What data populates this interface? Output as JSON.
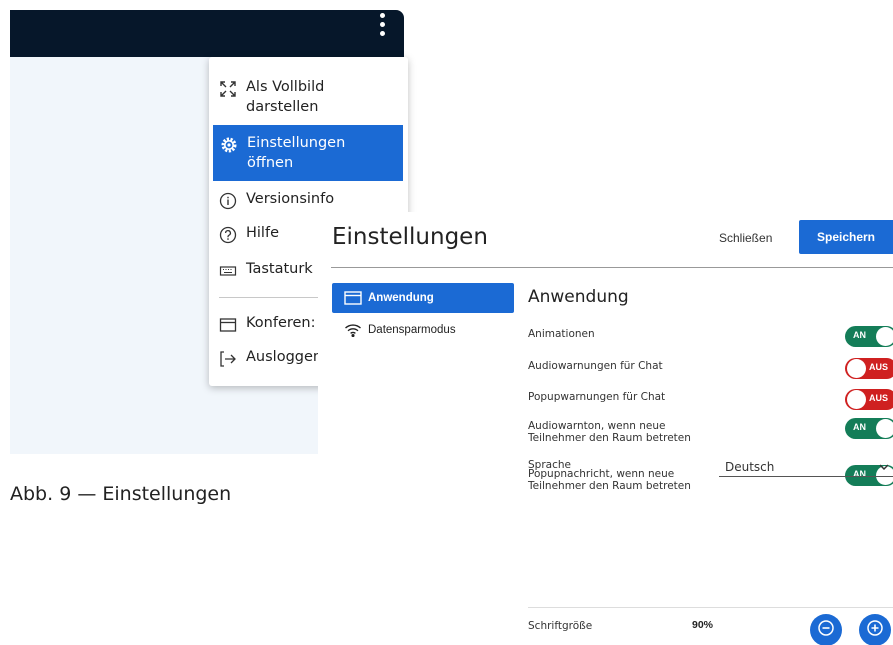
{
  "app_menu": {
    "items": [
      {
        "label": "Als Vollbild\ndarstellen",
        "icon": "fullscreen-icon"
      },
      {
        "label": "Einstellungen\nöffnen",
        "icon": "gear-icon",
        "active": true
      },
      {
        "label": "Versionsinfo",
        "icon": "info-icon"
      },
      {
        "label": "Hilfe",
        "icon": "help-icon"
      },
      {
        "label": "Tastaturk",
        "icon": "keyboard-icon"
      },
      {
        "label": "Konferen:",
        "icon": "window-icon"
      },
      {
        "label": "Ausloggen",
        "icon": "logout-icon"
      }
    ]
  },
  "caption": "Abb. 9 — Einstellungen",
  "dialog": {
    "title": "Einstellungen",
    "close_label": "Schließen",
    "save_label": "Speichern",
    "nav": [
      {
        "label": "Anwendung",
        "icon": "window-icon",
        "active": true
      },
      {
        "label": "Datensparmodus",
        "icon": "wifi-icon"
      }
    ],
    "section_title": "Anwendung",
    "settings": [
      {
        "label": "Animationen",
        "state": "on",
        "state_label": "AN"
      },
      {
        "label": "Audiowarnungen für Chat",
        "state": "off",
        "state_label": "AUS"
      },
      {
        "label": "Popupwarnungen für Chat",
        "state": "off",
        "state_label": "AUS"
      },
      {
        "label": "Audiowarnton, wenn neue\nTeilnehmer den Raum betreten",
        "state": "on",
        "state_label": "AN"
      },
      {
        "label": "Popupnachricht, wenn neue\nTeilnehmer den Raum betreten",
        "state": "on",
        "state_label": "AN"
      }
    ],
    "language": {
      "label": "Sprache",
      "value": "Deutsch"
    },
    "font_size": {
      "label": "Schriftgröße",
      "value": "90%"
    }
  },
  "colors": {
    "accent": "#1b6ad4",
    "toggle_on": "#147d58",
    "toggle_off": "#cf2020",
    "topbar": "#06172a"
  }
}
